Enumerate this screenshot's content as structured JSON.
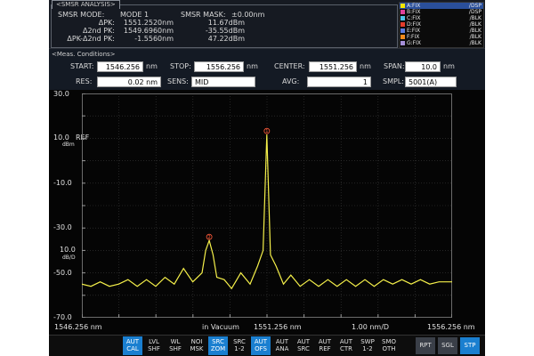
{
  "analysis": {
    "panel_title": "<SMSR ANALYSIS>",
    "mode_label": "SMSR MODE:",
    "mode_value": "MODE 1",
    "mask_label": "SMSR MASK:",
    "mask_value": "±0.00nm",
    "dpk_label": "ΔPK:",
    "dpk_wl": "1551.2520nm",
    "dpk_lvl": "11.67dBm",
    "d2pk_label": "Δ2nd PK:",
    "d2pk_wl": "1549.6960nm",
    "d2pk_lvl": "-35.55dBm",
    "diff_label": "ΔPK-Δ2nd PK:",
    "diff_wl": "-1.5560nm",
    "diff_lvl": "47.22dBm"
  },
  "traces": [
    {
      "label": "A:FIX",
      "status": "/DSP",
      "color": "#f2e600",
      "selected": true
    },
    {
      "label": "B:FIX",
      "status": "/DSP",
      "color": "#e0419a",
      "selected": false
    },
    {
      "label": "C:FIX",
      "status": "/BLK",
      "color": "#4fc2e8",
      "selected": false
    },
    {
      "label": "D:FIX",
      "status": "/BLK",
      "color": "#e23c2c",
      "selected": false
    },
    {
      "label": "E:FIX",
      "status": "/BLK",
      "color": "#5a7be0",
      "selected": false
    },
    {
      "label": "F:FIX",
      "status": "/BLK",
      "color": "#f08a1c",
      "selected": false
    },
    {
      "label": "G:FIX",
      "status": "/BLK",
      "color": "#a58fd8",
      "selected": false
    }
  ],
  "meas": {
    "title": "<Meas. Conditions>",
    "start_label": "START:",
    "start_value": "1546.256",
    "start_unit": "nm",
    "stop_label": "STOP:",
    "stop_value": "1556.256",
    "stop_unit": "nm",
    "center_label": "CENTER:",
    "center_value": "1551.256",
    "center_unit": "nm",
    "span_label": "SPAN:",
    "span_value": "10.0",
    "span_unit": "nm",
    "res_label": "RES:",
    "res_value": "0.02 nm",
    "sens_label": "SENS:",
    "sens_value": "MID",
    "avg_label": "AVG:",
    "avg_value": "1",
    "smpl_label": "SMPL:",
    "smpl_value": "5001(A)"
  },
  "graph": {
    "y_ticks": [
      "30.0",
      "10.0",
      "-10.0",
      "-30.0",
      "-50.0",
      "-70.0"
    ],
    "ref_label": "REF",
    "unit_top": "dBm",
    "unit_div": "10.0",
    "unit_div2": "dB/D",
    "x_start": "1546.256 nm",
    "x_medium": "in Vacuum",
    "x_center": "1551.256 nm",
    "x_div": "1.00 nm/D",
    "x_stop": "1556.256 nm",
    "marker_main": "1",
    "marker_side": "2"
  },
  "chart_data": {
    "type": "line",
    "x_unit": "nm",
    "y_unit": "dBm",
    "xlim": [
      1546.256,
      1556.256
    ],
    "ylim": [
      -70,
      30
    ],
    "grid": true,
    "series": [
      {
        "color": "#f5f04a",
        "x": [
          1546.256,
          1546.5,
          1546.75,
          1547.0,
          1547.25,
          1547.5,
          1547.75,
          1548.0,
          1548.25,
          1548.5,
          1548.75,
          1549.0,
          1549.25,
          1549.5,
          1549.6,
          1549.696,
          1549.8,
          1549.9,
          1550.1,
          1550.3,
          1550.55,
          1550.8,
          1551.0,
          1551.15,
          1551.252,
          1551.35,
          1551.5,
          1551.7,
          1551.9,
          1552.15,
          1552.4,
          1552.65,
          1552.9,
          1553.15,
          1553.4,
          1553.65,
          1553.9,
          1554.15,
          1554.4,
          1554.65,
          1554.9,
          1555.15,
          1555.4,
          1555.65,
          1555.9,
          1556.256
        ],
        "y": [
          -55,
          -56,
          -54,
          -56,
          -55,
          -53,
          -56,
          -53,
          -56,
          -52,
          -55,
          -48,
          -54,
          -50,
          -40,
          -35.55,
          -42,
          -52,
          -53,
          -57,
          -50,
          -55,
          -47,
          -40,
          11.67,
          -42,
          -47,
          -55,
          -51,
          -56,
          -53,
          -56,
          -53,
          -56,
          -53,
          -56,
          -53,
          -56,
          -53,
          -55,
          -53,
          -55,
          -53,
          -55,
          -54,
          -54
        ]
      }
    ],
    "markers": [
      {
        "label": "1",
        "x": 1551.252,
        "y": 11.67
      },
      {
        "label": "2",
        "x": 1549.696,
        "y": -35.55
      }
    ]
  },
  "softkeys": [
    {
      "l1": "AUT",
      "l2": "CAL",
      "on": true
    },
    {
      "l1": "LVL",
      "l2": "SHF",
      "on": false
    },
    {
      "l1": "WL",
      "l2": "SHF",
      "on": false
    },
    {
      "l1": "NOI",
      "l2": "MSK",
      "on": false
    },
    {
      "l1": "SRC",
      "l2": "ZOM",
      "on": true
    },
    {
      "l1": "SRC",
      "l2": "1-2",
      "on": false
    },
    {
      "l1": "AUT",
      "l2": "OFS",
      "on": true
    },
    {
      "l1": "AUT",
      "l2": "ANA",
      "on": false
    },
    {
      "l1": "AUT",
      "l2": "SRC",
      "on": false
    },
    {
      "l1": "AUT",
      "l2": "REF",
      "on": false
    },
    {
      "l1": "AUT",
      "l2": "CTR",
      "on": false
    },
    {
      "l1": "SWP",
      "l2": "1-2",
      "on": false
    },
    {
      "l1": "SMO",
      "l2": "OTH",
      "on": false
    }
  ],
  "run_keys": [
    {
      "label": "RPT",
      "on": false
    },
    {
      "label": "SGL",
      "on": false
    },
    {
      "label": "STP",
      "on": true
    }
  ]
}
